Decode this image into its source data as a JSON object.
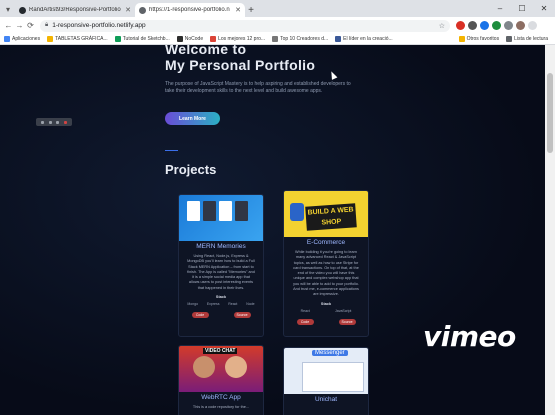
{
  "browser": {
    "tabs": [
      {
        "title": "RandArtist93/Responsive-Portfolio",
        "active": false,
        "favicon_color": "#24292e"
      },
      {
        "title": "https://1-responsive-portfolio.n",
        "active": true,
        "favicon_color": "#5f6368"
      }
    ],
    "new_tab": "+",
    "window_controls": [
      "–",
      "☐",
      "✕"
    ],
    "url": "1-responsive-portfolio.netlify.app",
    "bookmarks": [
      {
        "label": "Aplicaciones",
        "color": "#4285f4"
      },
      {
        "label": "TABLETAS GRÁFICA...",
        "color": "#f4b400"
      },
      {
        "label": "Tutorial de Sketchb...",
        "color": "#0f9d58"
      },
      {
        "label": "NoCode",
        "color": "#2d2d2d"
      },
      {
        "label": "Los mejores 12 pro...",
        "color": "#db4437"
      },
      {
        "label": "Top 10 Creadores d...",
        "color": "#777777"
      },
      {
        "label": "El líder en la creació...",
        "color": "#3b5998"
      }
    ],
    "bookmarks_right": [
      {
        "label": "Otros favoritos",
        "color": "#f4b400"
      },
      {
        "label": "Lista de lectura",
        "color": "#5f6368"
      }
    ]
  },
  "hero": {
    "title_line1": "Welcome to",
    "title_line2": "My Personal Portfolio",
    "description": "The purpose of JavaScript Mastery is to help aspiring and established developers to take their development skills to the next level and build awesome apps.",
    "cta": "Learn More"
  },
  "projects": {
    "heading": "Projects",
    "cards": [
      {
        "name": "MERN Memories",
        "description": "Using React, Node.js, Express & MongoDB you'll learn how to build a Full Stack MERN Application – from start to finish. The App is called \"Memories\" and it is a simple social media app that allows users to post interesting events that happened in their lives.",
        "stack_label": "Stack",
        "stack": [
          "Mongo",
          "Express",
          "React",
          "Node"
        ],
        "buttons": [
          "Code",
          "Source"
        ]
      },
      {
        "name": "E-Commerce",
        "sign_text": "BUILD A WEB SHOP",
        "description": "While building it you're going to learn many advanced React & JavaScript topics, as well as how to use Stripe for card transactions. On top of that, at the end of the video you will have this unique and complex webshop app that you will be able to add to your portfolio. And trust me, e-commerce applications are impressive.",
        "stack_label": "Stack",
        "stack": [
          "React",
          "JavaScript"
        ],
        "buttons": [
          "Code",
          "Source"
        ]
      },
      {
        "name": "WebRTC App",
        "overlay_text": "VIDEO CHAT",
        "description": "This is a code repository for the...",
        "stack_label": "",
        "stack": [],
        "buttons": []
      },
      {
        "name": "Unichat",
        "overlay_text": "Messenger",
        "description": "",
        "stack_label": "",
        "stack": [],
        "buttons": []
      }
    ]
  },
  "watermark": "vimeo"
}
